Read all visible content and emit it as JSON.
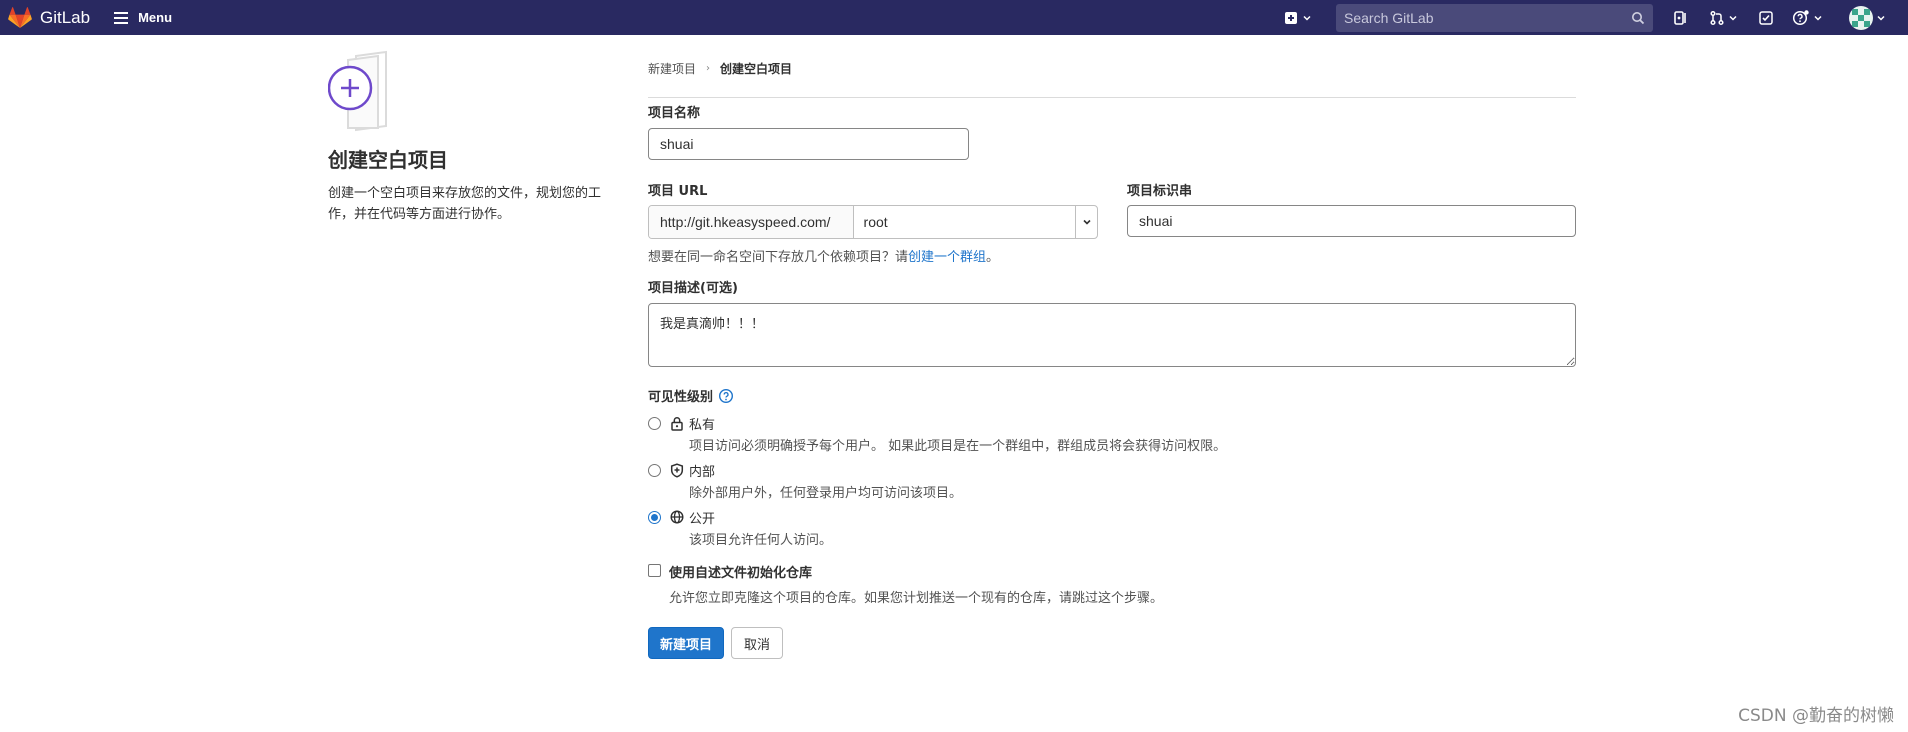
{
  "navbar": {
    "brand": "GitLab",
    "menu_label": "Menu",
    "search_placeholder": "Search GitLab",
    "icons": [
      "plus-square-icon",
      "search-icon",
      "issues-icon",
      "merge-request-icon",
      "todo-icon",
      "help-icon",
      "avatar"
    ]
  },
  "left": {
    "title": "创建空白项目",
    "description": "创建一个空白项目来存放您的文件，规划您的工作，并在代码等方面进行协作。"
  },
  "breadcrumb": {
    "parent": "新建项目",
    "current": "创建空白项目"
  },
  "form": {
    "name_label": "项目名称",
    "name_value": "shuai",
    "url_label": "项目 URL",
    "url_prefix": "http://git.hkeasyspeed.com/",
    "namespace_value": "root",
    "slug_label": "项目标识串",
    "slug_value": "shuai",
    "group_help_prefix": "想要在同一命名空间下存放几个依赖项目？请",
    "group_help_link": "创建一个群组",
    "group_help_suffix": "。",
    "description_label": "项目描述(可选)",
    "description_value": "我是真滴帅！！！",
    "visibility_label": "可见性级别",
    "visibility": [
      {
        "title": "私有",
        "desc": "项目访问必须明确授予每个用户。 如果此项目是在一个群组中，群组成员将会获得访问权限。",
        "icon": "lock-icon",
        "checked": false
      },
      {
        "title": "内部",
        "desc": "除外部用户外，任何登录用户均可访问该项目。",
        "icon": "shield-icon",
        "checked": false
      },
      {
        "title": "公开",
        "desc": "该项目允许任何人访问。",
        "icon": "earth-icon",
        "checked": true
      }
    ],
    "readme_label": "使用自述文件初始化仓库",
    "readme_desc": "允许您立即克隆这个项目的仓库。如果您计划推送一个现有的仓库，请跳过这个步骤。",
    "readme_checked": false,
    "create_button": "新建项目",
    "cancel_button": "取消"
  },
  "watermark": "CSDN @勤奋的树懒",
  "colors": {
    "navbar": "#292961",
    "primary": "#1f75cb",
    "illustration_accent": "#6e49cb"
  }
}
